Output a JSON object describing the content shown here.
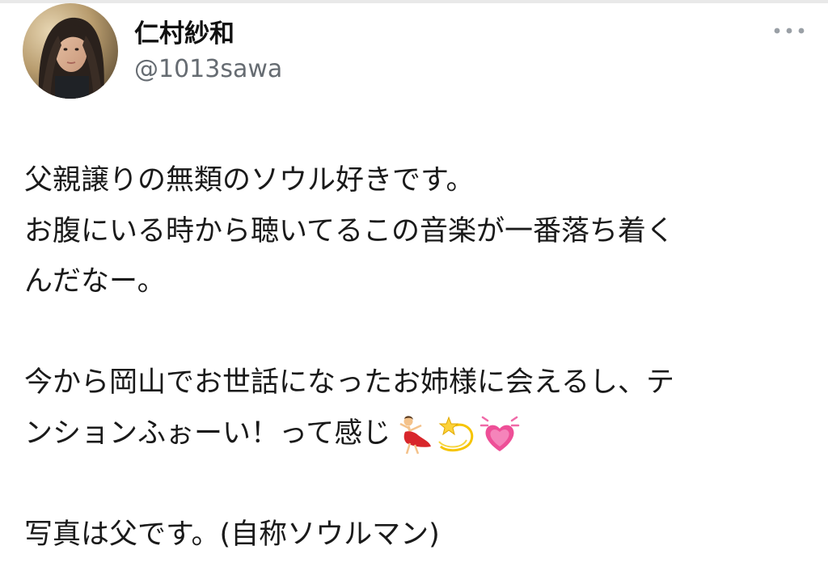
{
  "user": {
    "display_name": "仁村紗和",
    "handle": "@1013sawa"
  },
  "menu": {
    "icon": "more-horizontal-icon"
  },
  "tweet": {
    "line1": "父親譲りの無類のソウル好きです。",
    "line2": "お腹にいる時から聴いてるこの音楽が一番落ち着く",
    "line3": "んだなー。",
    "line4": "今から岡山でお世話になったお姉様に会えるし、テ",
    "line5": "ンションふぉーい！って感じ",
    "line6": "写真は父です。(自称ソウルマン)",
    "emojis": [
      "dancer-emoji",
      "dizzy-star-emoji",
      "growing-heart-emoji"
    ]
  },
  "colors": {
    "text": "#1a1a1a",
    "handle": "#666c72",
    "menu_dots": "#9aa0a6"
  }
}
